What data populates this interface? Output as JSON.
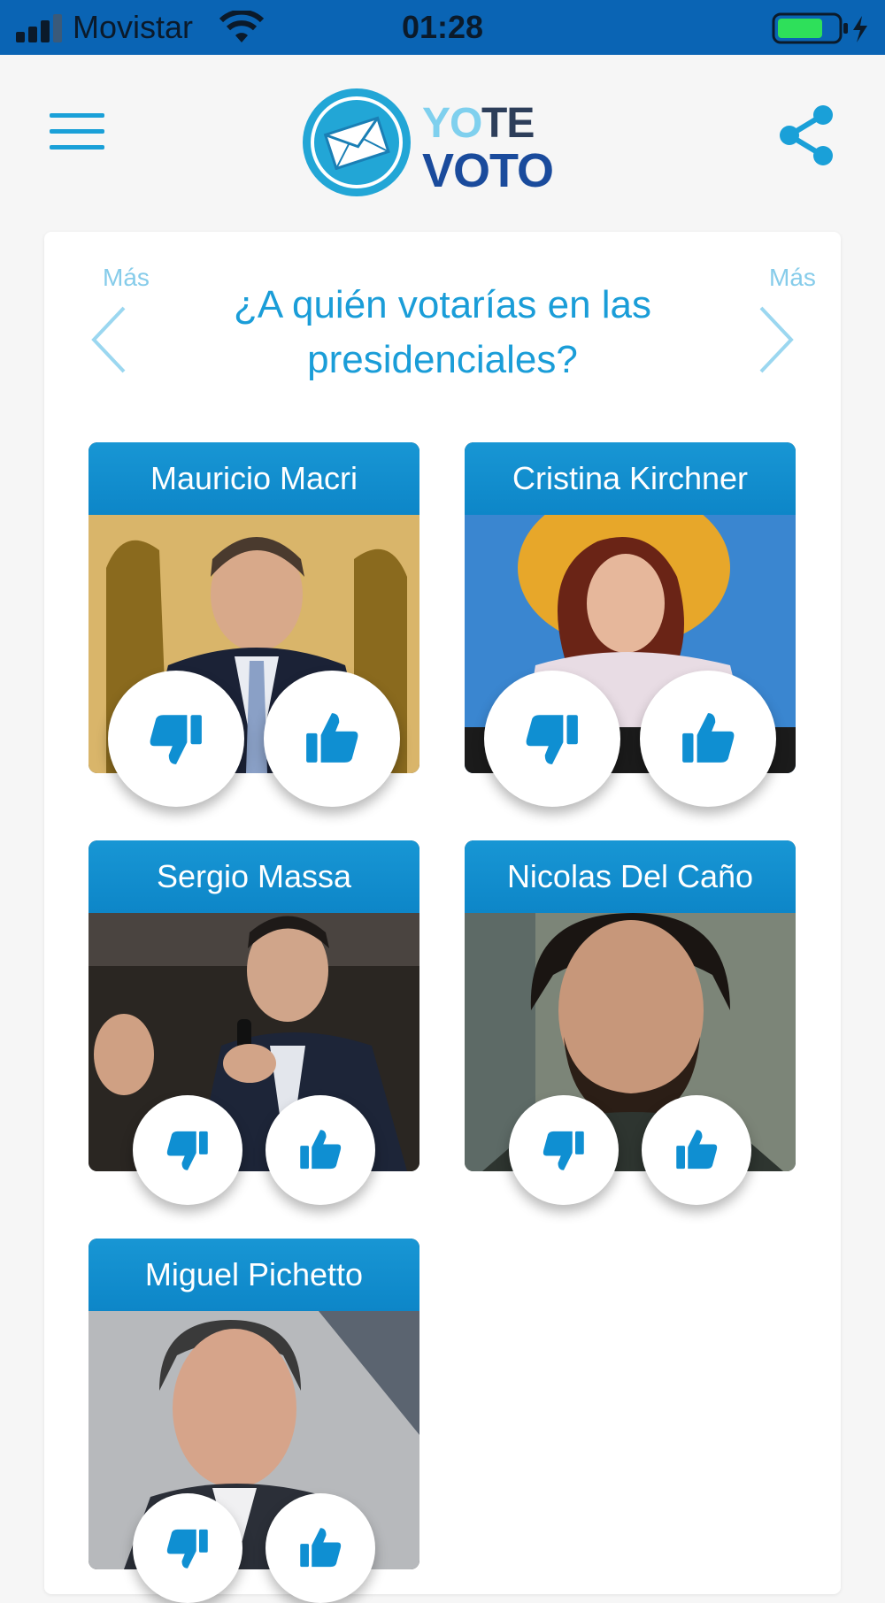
{
  "status_bar": {
    "carrier": "Movistar",
    "time": "01:28",
    "signal_icon": "cellular-signal-icon",
    "wifi_icon": "wifi-icon",
    "battery_icon": "battery-charging-icon"
  },
  "header": {
    "menu_icon": "hamburger-menu-icon",
    "logo": {
      "word1": "YO",
      "word2": "TE",
      "word3": "VOTO",
      "icon": "envelope-icon"
    },
    "share_icon": "share-icon"
  },
  "poll": {
    "more_left": "Más",
    "more_right": "Más",
    "question": "¿A quién votarías en las presidenciales?",
    "candidates": [
      {
        "name": "Mauricio Macri"
      },
      {
        "name": "Cristina Kirchner"
      },
      {
        "name": "Sergio Massa"
      },
      {
        "name": "Nicolas Del Caño"
      },
      {
        "name": "Miguel Pichetto"
      }
    ]
  },
  "icons": {
    "thumbs_down": "thumbs-down-icon",
    "thumbs_up": "thumbs-up-icon",
    "prev": "chevron-left-icon",
    "next": "chevron-right-icon"
  },
  "colors": {
    "status_bar": "#0a64b4",
    "accent": "#1a9dd8",
    "tile_header": "#1896d4",
    "background": "#f6f6f6"
  }
}
